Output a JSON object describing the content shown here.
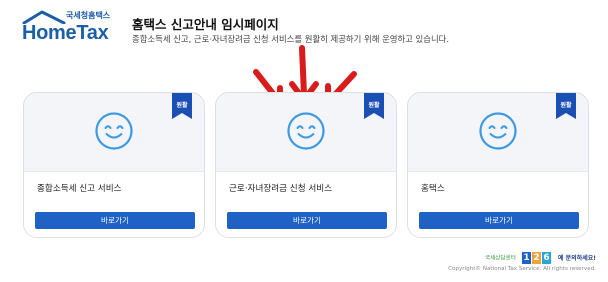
{
  "header": {
    "logo_ko": "국세청홈택스",
    "logo_en": "HomeTax",
    "title": "홈택스 신고안내 임시페이지",
    "description": "종합소득세 신고, 근로·자녀장려금 신청 서비스를 원활히 제공하기 위해 운영하고 있습니다."
  },
  "cards": [
    {
      "badge": "원활",
      "label": "종합소득세 신고 서비스",
      "button": "바로가기",
      "icon": "smiley-face-icon"
    },
    {
      "badge": "원활",
      "label": "근로·자녀장려금 신청 서비스",
      "button": "바로가기",
      "icon": "smiley-face-icon"
    },
    {
      "badge": "원활",
      "label": "홈택스",
      "button": "바로가기",
      "icon": "smiley-face-icon"
    }
  ],
  "footer": {
    "help_prefix": "국세상담센터",
    "help_digits": [
      "1",
      "2",
      "6"
    ],
    "help_suffix": "에 문의하세요!",
    "copyright": "Copyright© National Tax Service. All rights reserved."
  },
  "colors": {
    "brand_blue": "#1e62c6",
    "badge_blue": "#1a4fb3",
    "face_blue": "#3b9ae6",
    "arrow_red": "#d81b1b"
  }
}
